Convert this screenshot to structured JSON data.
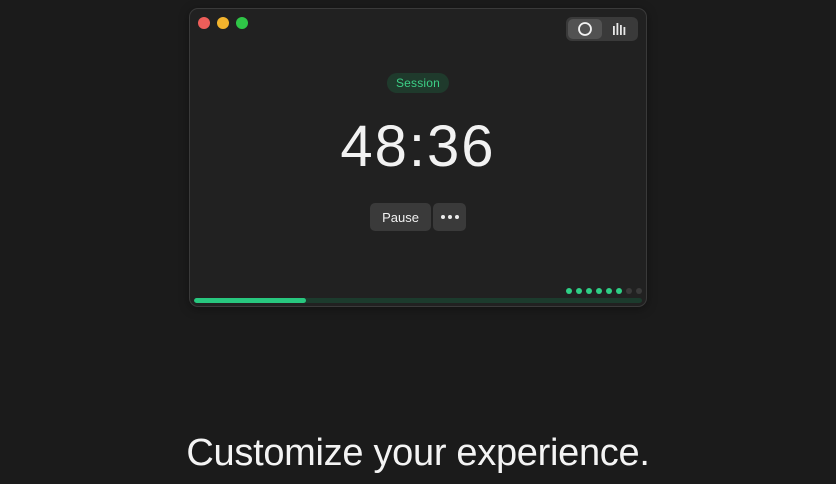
{
  "window": {
    "traffic_lights": [
      "close",
      "minimize",
      "zoom"
    ],
    "view_toggle": {
      "options": [
        {
          "icon": "circle-icon",
          "active": true
        },
        {
          "icon": "bar-chart-icon",
          "active": false
        }
      ]
    }
  },
  "timer": {
    "session_label": "Session",
    "time": "48:36",
    "pause_label": "Pause",
    "more_icon": "more-horizontal-icon",
    "progress": 0.25,
    "steps_total": 8,
    "steps_completed": 6
  },
  "caption": "Customize your experience.",
  "colors": {
    "accent": "#28c77f",
    "background": "#1b1b1b",
    "window": "#212121"
  }
}
